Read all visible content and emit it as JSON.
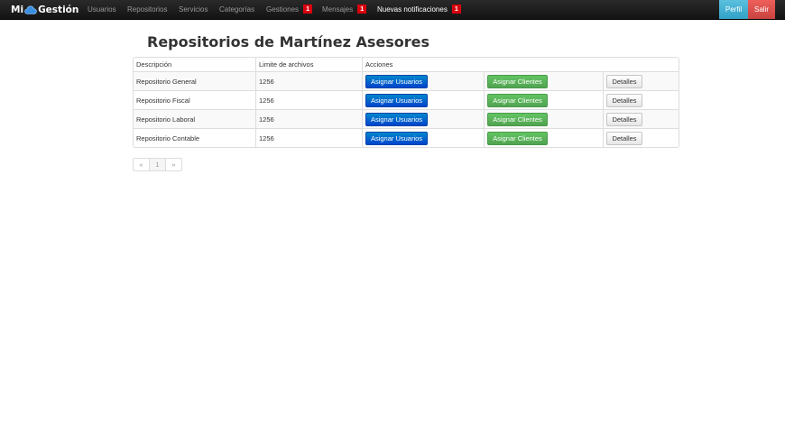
{
  "navbar": {
    "brand_left": "Mi",
    "brand_right": "Gestión",
    "items": [
      {
        "label": "Usuarios"
      },
      {
        "label": "Repositorios"
      },
      {
        "label": "Servicios"
      },
      {
        "label": "Categorías"
      },
      {
        "label": "Gestiones",
        "badge": "1"
      },
      {
        "label": "Mensajes",
        "badge": "1"
      },
      {
        "label": "Nuevas notificaciones",
        "badge": "1"
      }
    ],
    "perfil_label": "Perfil",
    "salir_label": "Salir"
  },
  "page": {
    "title": "Repositorios de Martínez Asesores"
  },
  "table": {
    "headers": [
      "Descripción",
      "Limite de archivos",
      "Acciones"
    ],
    "rows": [
      {
        "description": "Repositorio General",
        "limit": "1256"
      },
      {
        "description": "Repositorio Fiscal",
        "limit": "1256"
      },
      {
        "description": "Repositorio Laboral",
        "limit": "1256"
      },
      {
        "description": "Repositorio Contable",
        "limit": "1256"
      }
    ],
    "assign_users_label": "Asignar Usuarios",
    "assign_clients_label": "Asignar Clientes",
    "details_label": "Detalles"
  },
  "pagination": {
    "prev": "«",
    "current": "1",
    "next": "»"
  },
  "colors": {
    "navbar_bg": "#1b1b1b",
    "badge": "#d9000d",
    "primary": "#0055cc",
    "success": "#5bb75b",
    "info": "#5bc0de",
    "danger": "#da4f49"
  }
}
